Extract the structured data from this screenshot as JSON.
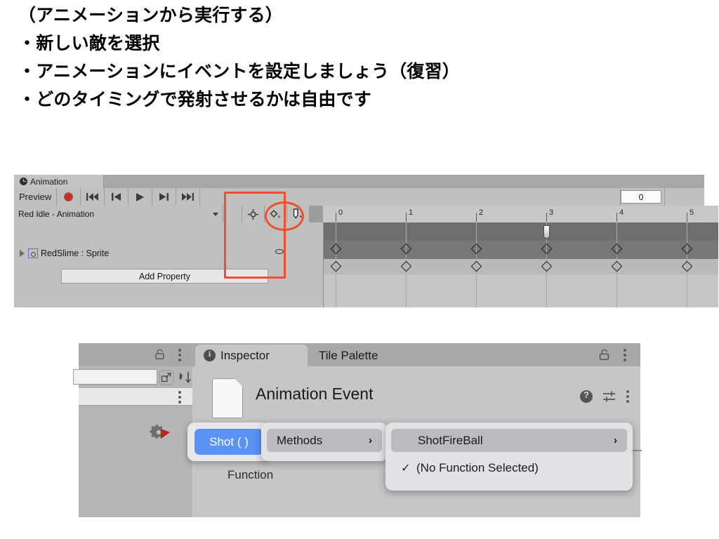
{
  "slide": {
    "lines": [
      "（アニメーションから実行する）",
      "・新しい敵を選択",
      "・アニメーションにイベントを設定しましょう（復習）",
      "・どのタイミングで発射させるかは自由です"
    ]
  },
  "animation_window": {
    "tab_label": "Animation",
    "tab_icon": "clock-icon",
    "toolbar": {
      "preview_label": "Preview",
      "record_icon": "record-icon",
      "first_frame_icon": "skip-to-start-icon",
      "prev_frame_icon": "step-back-icon",
      "play_icon": "play-icon",
      "next_frame_icon": "step-forward-icon",
      "last_frame_icon": "skip-to-end-icon",
      "frame_value": "0"
    },
    "clip_selector": {
      "value": "Red Idle - Animation",
      "caret_icon": "chevron-down-icon"
    },
    "row2_buttons": [
      {
        "name": "add-keyframe-icon",
        "label": ""
      },
      {
        "name": "add-keyframe-diamond-icon",
        "label": ""
      },
      {
        "name": "add-event-icon",
        "label": ""
      }
    ],
    "hierarchy": {
      "expand_icon": "triangle-right-icon",
      "item_icon": "sprite-icon",
      "item_label": "RedSlime : Sprite",
      "curve_icon": "ellipse-icon"
    },
    "add_property_label": "Add Property",
    "ruler": {
      "ticks": [
        "0",
        "1",
        "2",
        "3",
        "4",
        "5"
      ]
    },
    "playhead_frame": "3",
    "keyframes_top": [
      "0",
      "1",
      "2",
      "3",
      "4",
      "5"
    ],
    "keyframes_bottom": [
      "0",
      "1",
      "2",
      "3",
      "4",
      "5"
    ],
    "annotations": {
      "circle_target": "add-event-button",
      "rect_target": "frame-3-column"
    }
  },
  "inspector_window": {
    "left_panel": {
      "lock_icon": "lock-icon",
      "kebab_icon": "more-options-icon",
      "expand_icon": "open-in-new-icon",
      "sort_icon": "sort-icon",
      "row_kebab_icon": "more-options-icon",
      "gear_icon": "gear-script-icon"
    },
    "tabs": [
      {
        "label": "Inspector",
        "icon": "info-icon",
        "active": true
      },
      {
        "label": "Tile Palette",
        "icon": "",
        "active": false
      }
    ],
    "lock_icon": "lock-icon",
    "kebab_icon": "more-options-icon",
    "header": {
      "doc_icon": "document-icon",
      "title": "Animation Event",
      "help_icon": "help-icon",
      "preset_icon": "preset-icon",
      "kebab_icon": "more-options-icon"
    },
    "function_label": "Function",
    "context_menu": {
      "selected_pill": "Shot ( )",
      "submenu_parent": {
        "label": "Methods",
        "chevron": "›"
      },
      "items": [
        {
          "label": "ShotFireBall",
          "chevron": "›",
          "checked": false,
          "highlighted": true
        },
        {
          "label": "(No Function Selected)",
          "chevron": "",
          "checked": true,
          "highlighted": false
        }
      ],
      "check_glyph": "✓"
    }
  },
  "colors": {
    "accent_red": "#f0502d",
    "accent_blue": "#5a93f5",
    "record_red": "#d12b20",
    "window_gray": "#c0c0c0"
  }
}
